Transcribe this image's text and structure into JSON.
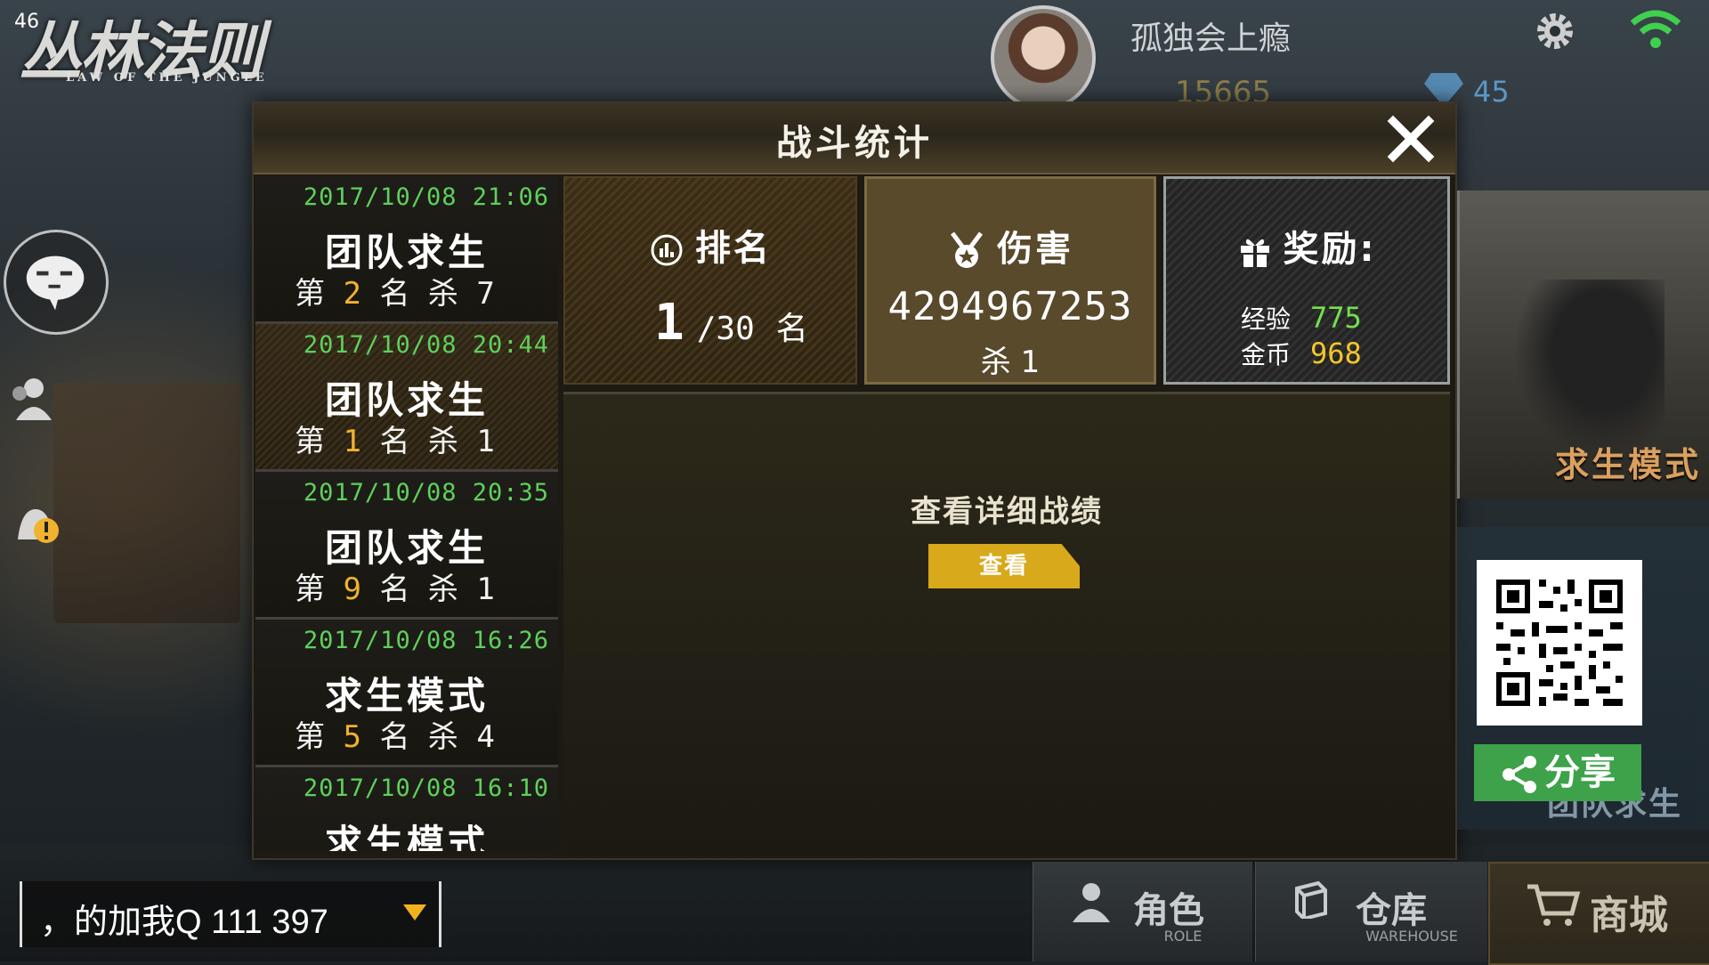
{
  "fps": "46",
  "logo": {
    "title": "丛林法则",
    "subtitle": "LAW OF THE JUNGLE"
  },
  "player": {
    "name": "孤独会上瘾",
    "coins": "15665",
    "gems": "45"
  },
  "dialog": {
    "title": "战斗统计",
    "matches": [
      {
        "time": "2017/10/08 21:06",
        "mode": "团队求生",
        "rank_prefix": "第 ",
        "rank": "2",
        "rank_suffix": " 名 杀 7"
      },
      {
        "time": "2017/10/08 20:44",
        "mode": "团队求生",
        "rank_prefix": "第 ",
        "rank": "1",
        "rank_suffix": " 名 杀 1"
      },
      {
        "time": "2017/10/08 20:35",
        "mode": "团队求生",
        "rank_prefix": "第 ",
        "rank": "9",
        "rank_suffix": " 名 杀 1"
      },
      {
        "time": "2017/10/08 16:26",
        "mode": "求生模式",
        "rank_prefix": "第 ",
        "rank": "5",
        "rank_suffix": " 名 杀 4"
      },
      {
        "time": "2017/10/08 16:10",
        "mode": "求生模式"
      }
    ],
    "rank_panel": {
      "title": "排名",
      "value": "1",
      "total": "/30",
      "unit": "名"
    },
    "damage_panel": {
      "title": "伤害",
      "value": "4294967253",
      "kills": "杀 1"
    },
    "reward_panel": {
      "title": "奖励:",
      "exp_label": "经验",
      "exp_value": "775",
      "gold_label": "金币",
      "gold_value": "968"
    },
    "detail_label": "查看详细战绩",
    "view_button": "查看"
  },
  "side": {
    "mode_card": "求生模式",
    "team_card": "团队求生",
    "share_button": "分享"
  },
  "chat": {
    "text": "，的加我Q 111 397"
  },
  "nav": {
    "role": {
      "label": "角色",
      "sub": "ROLE"
    },
    "warehouse": {
      "label": "仓库",
      "sub": "WAREHOUSE"
    },
    "shop": {
      "label": "商城"
    }
  },
  "colors": {
    "time_green": "#5fd05a",
    "rank_orange": "#f1b22d",
    "exp_green": "#73e14e",
    "gold_yellow": "#f3c62b",
    "button_gold": "#d9a91c",
    "share_green": "#3ea24a"
  }
}
